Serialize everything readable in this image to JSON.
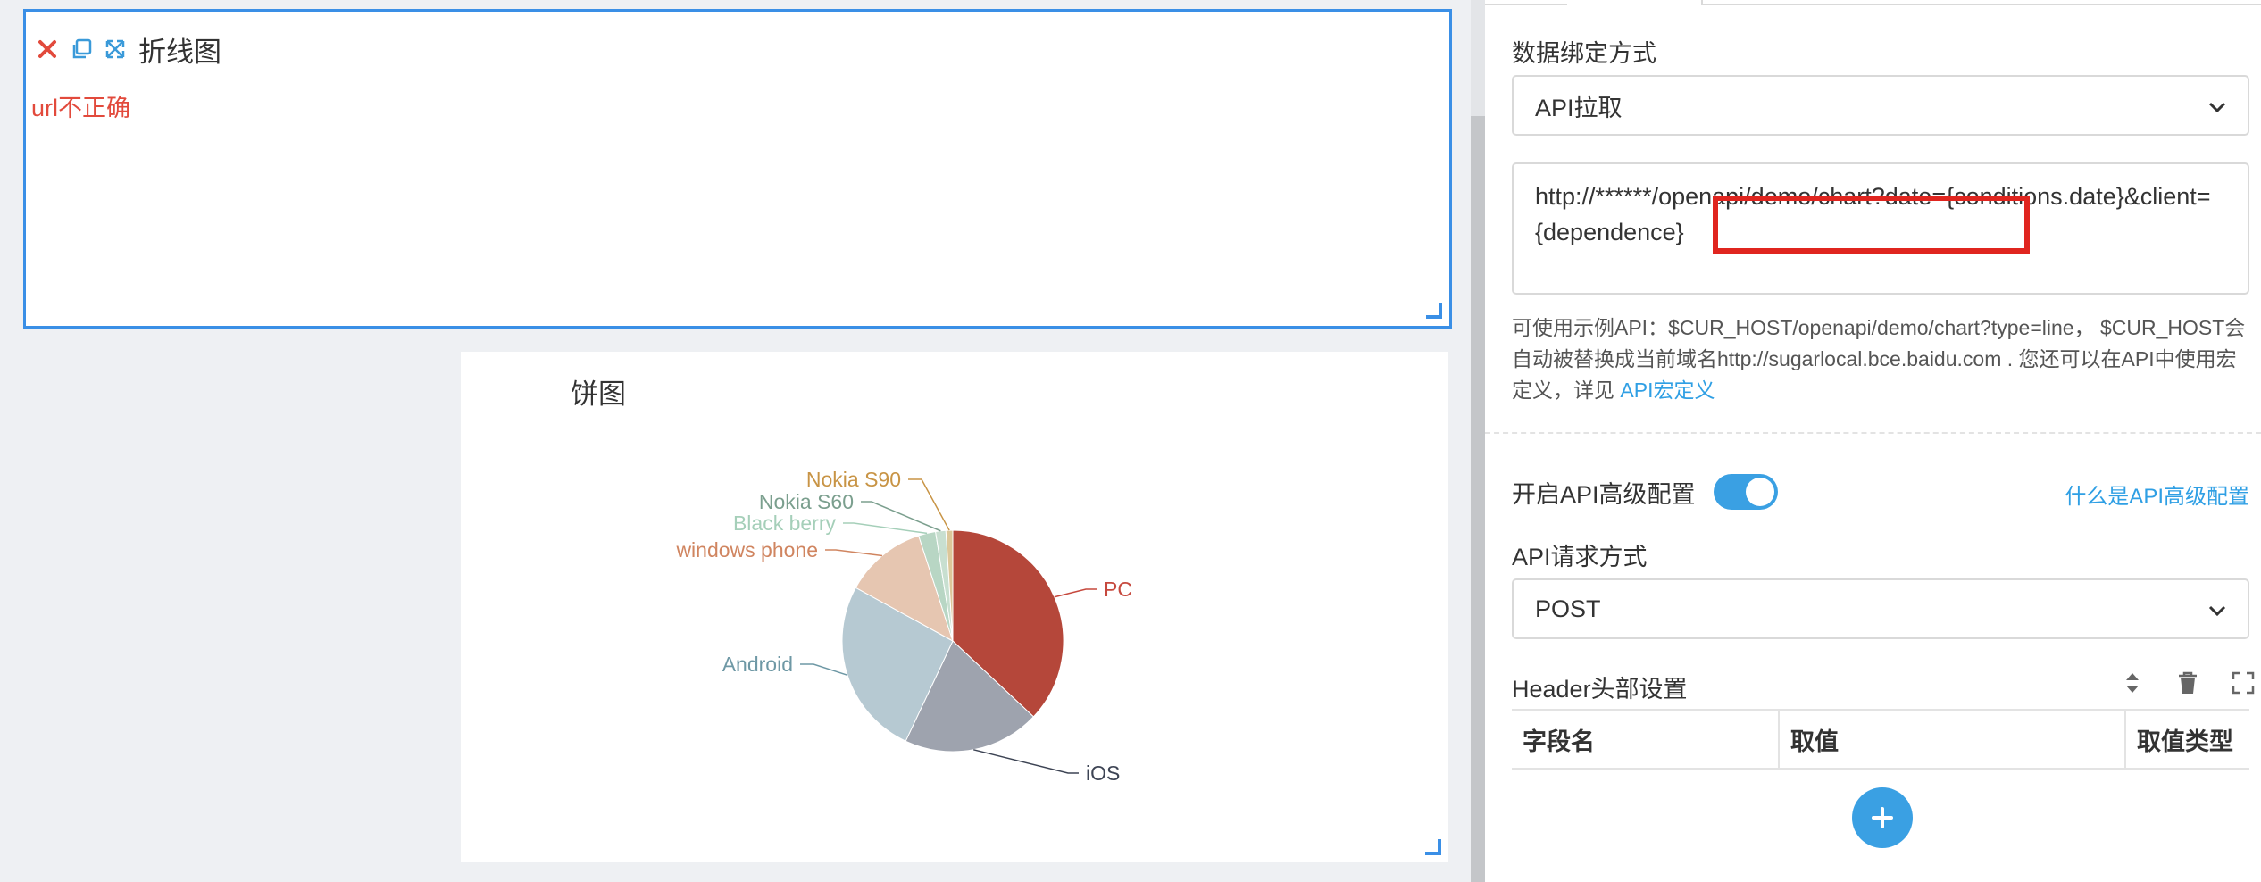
{
  "canvas": {
    "line_widget": {
      "title": "折线图",
      "error": "url不正确",
      "toolbar": [
        "close-icon",
        "copy-icon",
        "expand-icon"
      ]
    },
    "pie_widget": {
      "title": "饼图"
    }
  },
  "panel": {
    "binding_label": "数据绑定方式",
    "binding_value": "API拉取",
    "url_value": "http://******/openapi/demo/chart?date={conditions.date}&client={dependence}",
    "help_text": "可使用示例API：$CUR_HOST/openapi/demo/chart?type=line， $CUR_HOST会自动被替换成当前域名http://sugarlocal.bce.baidu.com . 您还可以在API中使用宏定义，详见 ",
    "help_link": "API宏定义",
    "advanced_label": "开启API高级配置",
    "advanced_enabled": true,
    "advanced_link": "什么是API高级配置",
    "method_label": "API请求方式",
    "method_value": "POST",
    "header_label": "Header头部设置",
    "header_columns": [
      "字段名",
      "取值",
      "取值类型"
    ],
    "header_icons": [
      "sort-icon",
      "trash-icon",
      "fullscreen-icon"
    ]
  },
  "colors": {
    "accent": "#3a8fe6",
    "link": "#2f9fe4",
    "error": "#e24a3c",
    "highlight": "#e0251f"
  },
  "chart_data": {
    "type": "pie",
    "title": "饼图",
    "categories": [
      "PC",
      "iOS",
      "Android",
      "windows phone",
      "Black berry",
      "Nokia S60",
      "Nokia S90"
    ],
    "values": [
      37,
      20,
      26,
      12,
      2.5,
      1.5,
      1
    ],
    "colors": [
      "#b5473a",
      "#9ea3ae",
      "#b6c9d2",
      "#e6c6b1",
      "#b8d6c4",
      "#c8dfd0",
      "#dcc79a"
    ],
    "label_colors": [
      "#c6483d",
      "#3d4454",
      "#6e98a5",
      "#d08560",
      "#a5cfb9",
      "#7b9f8e",
      "#c89445"
    ]
  }
}
